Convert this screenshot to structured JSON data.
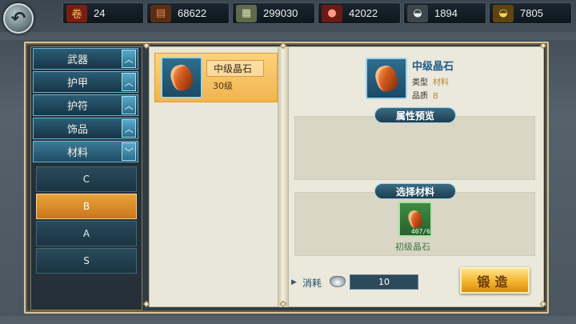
{
  "resources": [
    {
      "icon": "tiered-scroll-icon",
      "value": "24",
      "color": "#c4392a"
    },
    {
      "icon": "wood-logs-icon",
      "value": "68622",
      "color": "#a0522d"
    },
    {
      "icon": "silver-bars-icon",
      "value": "299030",
      "color": "#9aa879"
    },
    {
      "icon": "meat-icon",
      "value": "42022",
      "color": "#c0392b"
    },
    {
      "icon": "silver-ingot-icon",
      "value": "1894",
      "color": "#c0c6cc"
    },
    {
      "icon": "gold-ingot-icon",
      "value": "7805",
      "color": "#f0b52a"
    }
  ],
  "categories": [
    {
      "label": "武器",
      "chevron": "︿"
    },
    {
      "label": "护甲",
      "chevron": "︿"
    },
    {
      "label": "护符",
      "chevron": "︿"
    },
    {
      "label": "饰品",
      "chevron": "︿"
    },
    {
      "label": "材料",
      "chevron": "﹀"
    }
  ],
  "subcategories": [
    "C",
    "B",
    "A",
    "S"
  ],
  "selected_subcategory": "B",
  "list_item": {
    "name": "中级晶石",
    "level": "30级"
  },
  "detail": {
    "name": "中级晶石",
    "type_label": "类型",
    "type_value": "材料",
    "quality_label": "品质",
    "quality_value": "B"
  },
  "sections": {
    "attribute_preview": "属性预览",
    "select_material": "选择材料"
  },
  "material": {
    "name": "初级晶石",
    "count": "407/6"
  },
  "cost": {
    "label": "消耗",
    "value": "10"
  },
  "forge_label": "锻造"
}
